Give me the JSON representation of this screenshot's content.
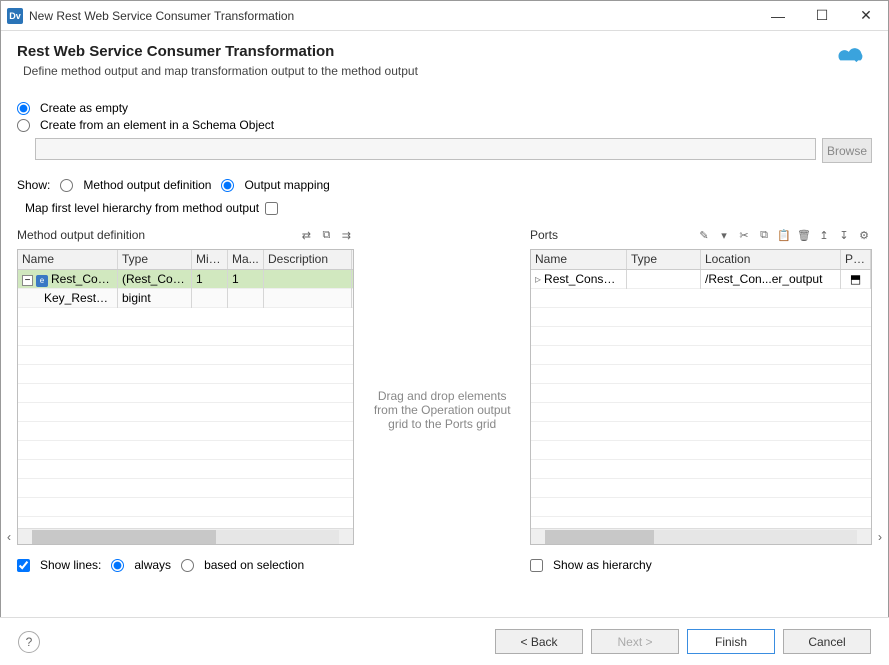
{
  "window": {
    "title": "New Rest Web Service Consumer Transformation"
  },
  "header": {
    "title": "Rest Web Service Consumer Transformation",
    "subtitle": "Define method output and map transformation output to the method output"
  },
  "create": {
    "empty": "Create as empty",
    "schema": "Create from an element in a Schema Object",
    "browse": "Browse"
  },
  "show": {
    "label": "Show:",
    "def": "Method output definition",
    "map": "Output mapping",
    "mapfirst": "Map first level hierarchy from method output"
  },
  "left": {
    "title": "Method output definition",
    "cols": [
      "Name",
      "Type",
      "Min...",
      "Ma...",
      "Description"
    ],
    "rows": [
      {
        "name": "Rest_Cons...",
        "type": "(Rest_Cons...",
        "min": "1",
        "max": "1",
        "desc": "",
        "sel": true,
        "element": true
      },
      {
        "name": "Key_Rest_C...",
        "type": "bigint",
        "min": "",
        "max": "",
        "desc": "",
        "sel": false,
        "child": true
      }
    ],
    "showlines": "Show lines:",
    "always": "always",
    "basedsel": "based on selection"
  },
  "mid": {
    "hint": "Drag and drop elements from the Operation output grid to the Ports grid"
  },
  "right": {
    "title": "Ports",
    "cols": [
      "Name",
      "Type",
      "Location",
      "Pre..."
    ],
    "rows": [
      {
        "name": "Rest_Consumer_output",
        "type": "",
        "loc": "/Rest_Con...er_output",
        "pre": ""
      }
    ],
    "showhier": "Show as hierarchy"
  },
  "footer": {
    "back": "< Back",
    "next": "Next >",
    "finish": "Finish",
    "cancel": "Cancel"
  }
}
